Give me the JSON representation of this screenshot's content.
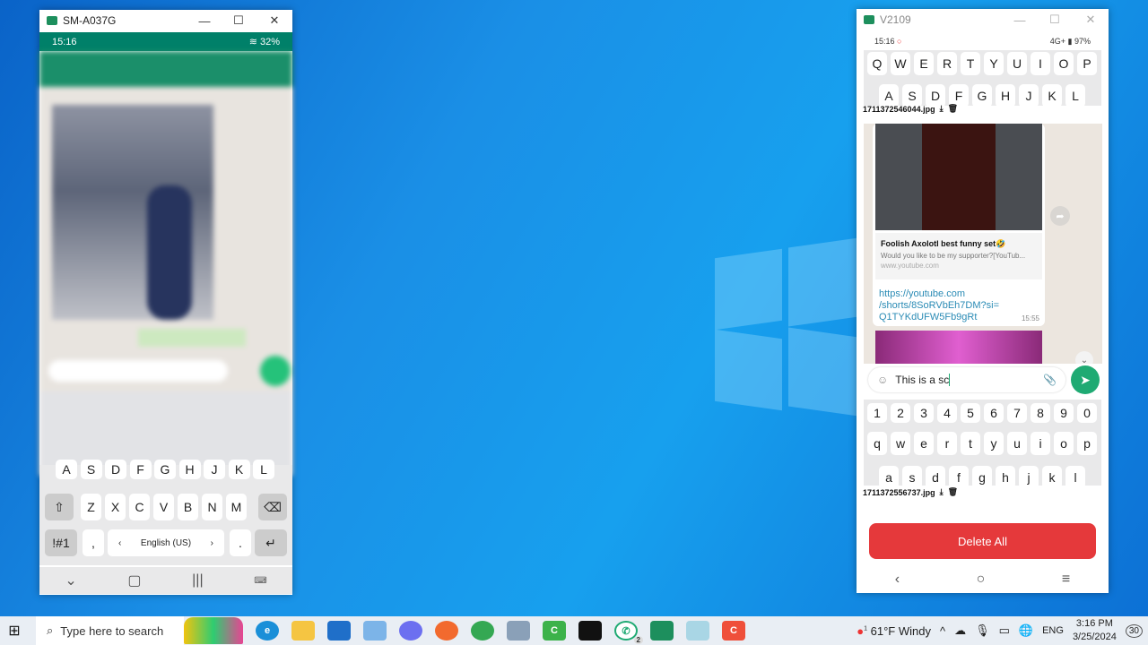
{
  "left_window": {
    "title": "SM-A037G",
    "status": {
      "time": "15:16",
      "battery": "32%"
    },
    "keyboard": {
      "row_top": [
        "A",
        "S",
        "D",
        "F",
        "G",
        "H",
        "J",
        "K",
        "L"
      ],
      "row_z": [
        "Z",
        "X",
        "C",
        "V",
        "B",
        "N",
        "M"
      ],
      "sym": "!#1",
      "comma": ",",
      "language": "English (US)",
      "period": "."
    }
  },
  "right_window": {
    "title": "V2109",
    "status": {
      "time": "15:16",
      "network": "4G+",
      "battery": "97%"
    },
    "keys_upper_1": [
      "Q",
      "W",
      "E",
      "R",
      "T",
      "Y",
      "U",
      "I",
      "O",
      "P"
    ],
    "keys_upper_2": [
      "A",
      "S",
      "D",
      "F",
      "G",
      "H",
      "J",
      "K",
      "L"
    ],
    "file1": "1711372546044.jpg",
    "preview": {
      "title": "Foolish Axolotl best funny set🤣",
      "desc": "Would you like to be my supporter?[YouTub...",
      "domain": "www.youtube.com"
    },
    "link": {
      "line1": "https://youtube.com",
      "line2": "/shorts/8SoRVbEh7DM?si=",
      "line3": "Q1TYKdUFW5Fb9gRt",
      "time": "15:55"
    },
    "input_value": "This is a sc",
    "keys_num": [
      "1",
      "2",
      "3",
      "4",
      "5",
      "6",
      "7",
      "8",
      "9",
      "0"
    ],
    "keys_lower_1": [
      "q",
      "w",
      "e",
      "r",
      "t",
      "y",
      "u",
      "i",
      "o",
      "p"
    ],
    "keys_lower_2": [
      "a",
      "s",
      "d",
      "f",
      "g",
      "h",
      "j",
      "k",
      "l"
    ],
    "file2": "1711372556737.jpg",
    "delete_all": "Delete All"
  },
  "taskbar": {
    "search_placeholder": "Type here to search",
    "whatsapp_badge": "2",
    "weather": "61°F  Windy",
    "weather_badge": "1",
    "lang": "ENG",
    "time": "3:16 PM",
    "date": "3/25/2024",
    "notifications": "30"
  },
  "colors": {
    "whatsapp_green": "#1faa73",
    "status_green": "#008069",
    "delete_red": "#e5393b",
    "link": "#2a8bb5"
  }
}
